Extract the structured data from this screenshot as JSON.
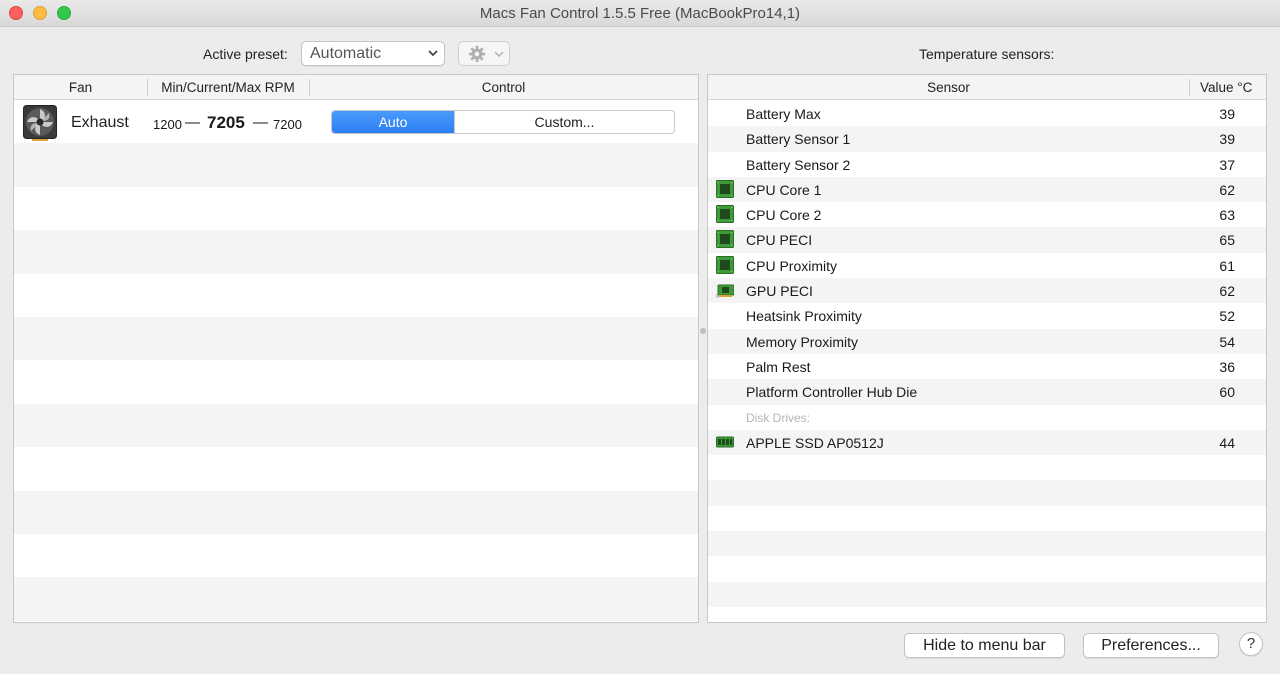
{
  "window": {
    "title": "Macs Fan Control 1.5.5 Free (MacBookPro14,1)"
  },
  "preset": {
    "label": "Active preset:",
    "value": "Automatic"
  },
  "fans": {
    "headers": {
      "fan": "Fan",
      "rpm": "Min/Current/Max RPM",
      "control": "Control"
    },
    "rows": [
      {
        "name": "Exhaust",
        "min": "1200",
        "current": "7205",
        "max": "7200",
        "dash": "—",
        "control_auto": "Auto",
        "control_custom": "Custom..."
      }
    ]
  },
  "sensors": {
    "title": "Temperature sensors:",
    "headers": {
      "sensor": "Sensor",
      "value": "Value °C"
    },
    "rows": [
      {
        "name": "Battery Max",
        "value": "39",
        "icon": "none"
      },
      {
        "name": "Battery Sensor 1",
        "value": "39",
        "icon": "none"
      },
      {
        "name": "Battery Sensor 2",
        "value": "37",
        "icon": "none"
      },
      {
        "name": "CPU Core 1",
        "value": "62",
        "icon": "cpu-chip-icon"
      },
      {
        "name": "CPU Core 2",
        "value": "63",
        "icon": "cpu-chip-icon"
      },
      {
        "name": "CPU PECI",
        "value": "65",
        "icon": "cpu-chip-icon"
      },
      {
        "name": "CPU Proximity",
        "value": "61",
        "icon": "cpu-chip-icon"
      },
      {
        "name": "GPU PECI",
        "value": "62",
        "icon": "gpu-card-icon"
      },
      {
        "name": "Heatsink Proximity",
        "value": "52",
        "icon": "none"
      },
      {
        "name": "Memory Proximity",
        "value": "54",
        "icon": "none"
      },
      {
        "name": "Palm Rest",
        "value": "36",
        "icon": "none"
      },
      {
        "name": "Platform Controller Hub Die",
        "value": "60",
        "icon": "none"
      },
      {
        "name": "Disk Drives:",
        "value": "",
        "icon": "none",
        "group": true
      },
      {
        "name": "APPLE SSD AP0512J",
        "value": "44",
        "icon": "ssd-icon"
      }
    ]
  },
  "buttons": {
    "hide": "Hide to menu bar",
    "preferences": "Preferences...",
    "help": "?"
  },
  "colors": {
    "accent": "#2c7ef5",
    "chip_green": "#3f9a3a"
  }
}
